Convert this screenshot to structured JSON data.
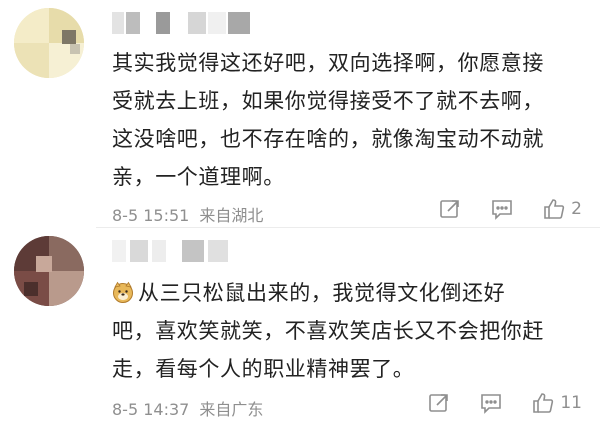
{
  "comments": [
    {
      "text": "其实我觉得这还好吧，双向选择啊，你愿意接\n受就去上班，如果你觉得接受不了就不去啊，\n这没啥吧，也不存在啥的，就像淘宝动不动就\n亲，一个道理啊。",
      "date": "8-5 15:51",
      "location": "来自湖北",
      "likes": "2",
      "avatar_icon": "pixelated-avatar-icon",
      "username_icon": "pixelated-username-icon"
    },
    {
      "emoji": "doge-emoji-icon",
      "text": "从三只松鼠出来的，我觉得文化倒还好\n吧，喜欢笑就笑，不喜欢笑店长又不会把你赶\n走，看每个人的职业精神罢了。",
      "date": "8-5 14:37",
      "location": "来自广东",
      "likes": "11",
      "avatar_icon": "pixelated-avatar-icon",
      "username_icon": "pixelated-username-icon"
    }
  ],
  "icons": {
    "share": "share-icon",
    "reply": "comment-icon",
    "like": "thumbs-up-icon"
  },
  "colors": {
    "text": "#222222",
    "meta": "#8f8f8f",
    "divider": "#ececec"
  }
}
